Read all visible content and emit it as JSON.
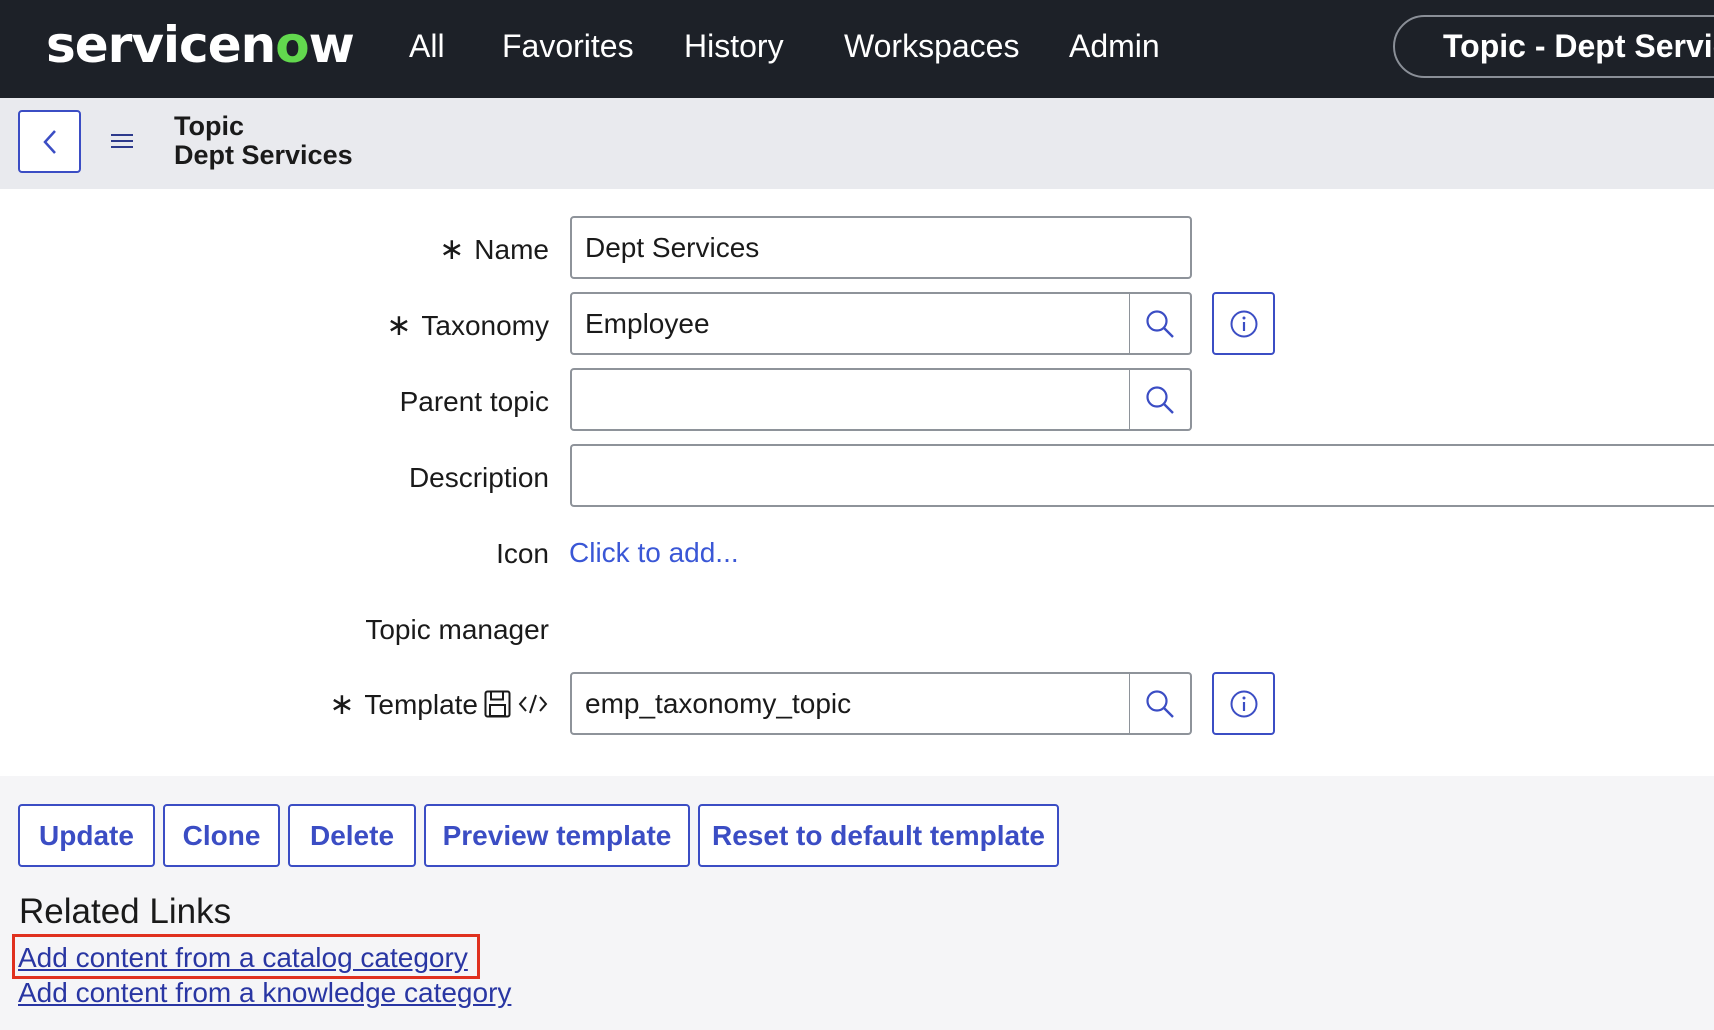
{
  "nav": {
    "logo_prefix": "servicen",
    "logo_o": "o",
    "logo_suffix": "w",
    "items": [
      "All",
      "Favorites",
      "History",
      "Workspaces",
      "Admin"
    ],
    "context": "Topic - Dept Services"
  },
  "header": {
    "record_type": "Topic",
    "record_name": "Dept Services"
  },
  "form": {
    "name": {
      "label": "Name",
      "required": "∗",
      "value": "Dept Services"
    },
    "taxonomy": {
      "label": "Taxonomy",
      "required": "∗",
      "value": "Employee"
    },
    "parent_topic": {
      "label": "Parent topic",
      "value": ""
    },
    "description": {
      "label": "Description",
      "value": ""
    },
    "icon": {
      "label": "Icon",
      "link": "Click to add..."
    },
    "topic_manager": {
      "label": "Topic manager"
    },
    "template": {
      "label": "Template",
      "required": "∗",
      "value": "emp_taxonomy_topic"
    }
  },
  "buttons": {
    "update": "Update",
    "clone": "Clone",
    "delete": "Delete",
    "preview": "Preview template",
    "reset": "Reset to default template"
  },
  "related": {
    "heading": "Related Links",
    "links": [
      "Add content from a catalog category",
      "Add content from a knowledge category"
    ]
  },
  "colors": {
    "nav_bg": "#1d2128",
    "accent": "#3b4dc4",
    "logo_green": "#62d84e",
    "highlight": "#e0311f"
  },
  "icons": [
    "chevron-left-icon",
    "hamburger-menu-icon",
    "search-icon",
    "info-icon",
    "save-icon",
    "code-icon"
  ]
}
